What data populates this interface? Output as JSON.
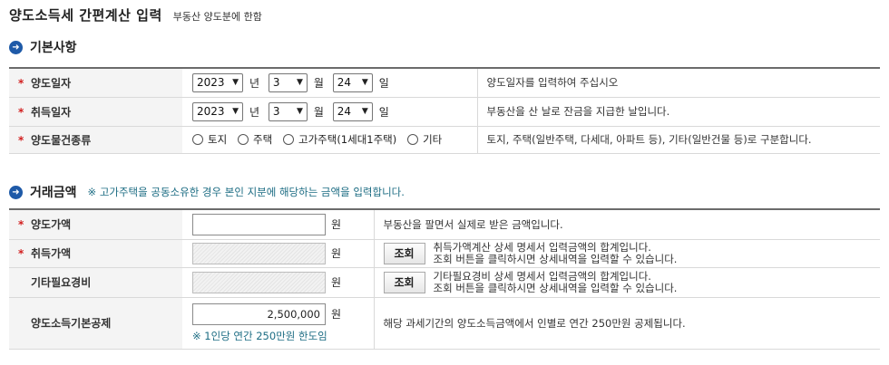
{
  "header": {
    "title": "양도소득세 간편계산 입력",
    "subtitle": "부동산 양도분에 한함"
  },
  "basic": {
    "icon": "arrow-right-circle-icon",
    "title": "기본사항",
    "rows": [
      {
        "label": "양도일자",
        "year": "2023",
        "year_unit": "년",
        "month": "3",
        "month_unit": "월",
        "day": "24",
        "day_unit": "일",
        "desc": "양도일자를 입력하여 주십시오"
      },
      {
        "label": "취득일자",
        "year": "2023",
        "year_unit": "년",
        "month": "3",
        "month_unit": "월",
        "day": "24",
        "day_unit": "일",
        "desc": "부동산을 산 날로 잔금을 지급한 날입니다."
      }
    ],
    "type_row": {
      "label": "양도물건종류",
      "options": [
        "토지",
        "주택",
        "고가주택(1세대1주택)",
        "기타"
      ],
      "desc": "토지, 주택(일반주택, 다세대, 아파트 등), 기타(일반건물 등)로 구분합니다."
    }
  },
  "trade": {
    "icon": "arrow-right-circle-icon",
    "title": "거래금액",
    "note": "※ 고가주택을 공동소유한 경우 본인 지분에 해당하는 금액을 입력합니다.",
    "currency_unit": "원",
    "lookup_label": "조회",
    "rows": {
      "sale_price": {
        "label": "양도가액",
        "value": "",
        "desc": "부동산을 팔면서 실제로 받은 금액입니다."
      },
      "acq_price": {
        "label": "취득가액",
        "value": "",
        "desc1": "취득가액계산 상세 명세서 입력금액의 합계입니다.",
        "desc2": "조회 버튼을 클릭하시면 상세내역을 입력할 수 있습니다."
      },
      "other_exp": {
        "label": "기타필요경비",
        "value": "",
        "desc1": "기타필요경비 상세 명세서 입력금액의 합계입니다.",
        "desc2": "조회 버튼을 클릭하시면 상세내역을 입력할 수 있습니다."
      },
      "deduction": {
        "label": "양도소득기본공제",
        "value": "2,500,000",
        "note": "※ 1인당 연간 250만원 한도임",
        "desc": "해당 과세기간의 양도소득금액에서 인별로 연간 250만원 공제됩니다."
      }
    }
  },
  "colors": {
    "accent": "#1e5aa8",
    "required": "#d21f1f",
    "note": "#1c6c83"
  }
}
